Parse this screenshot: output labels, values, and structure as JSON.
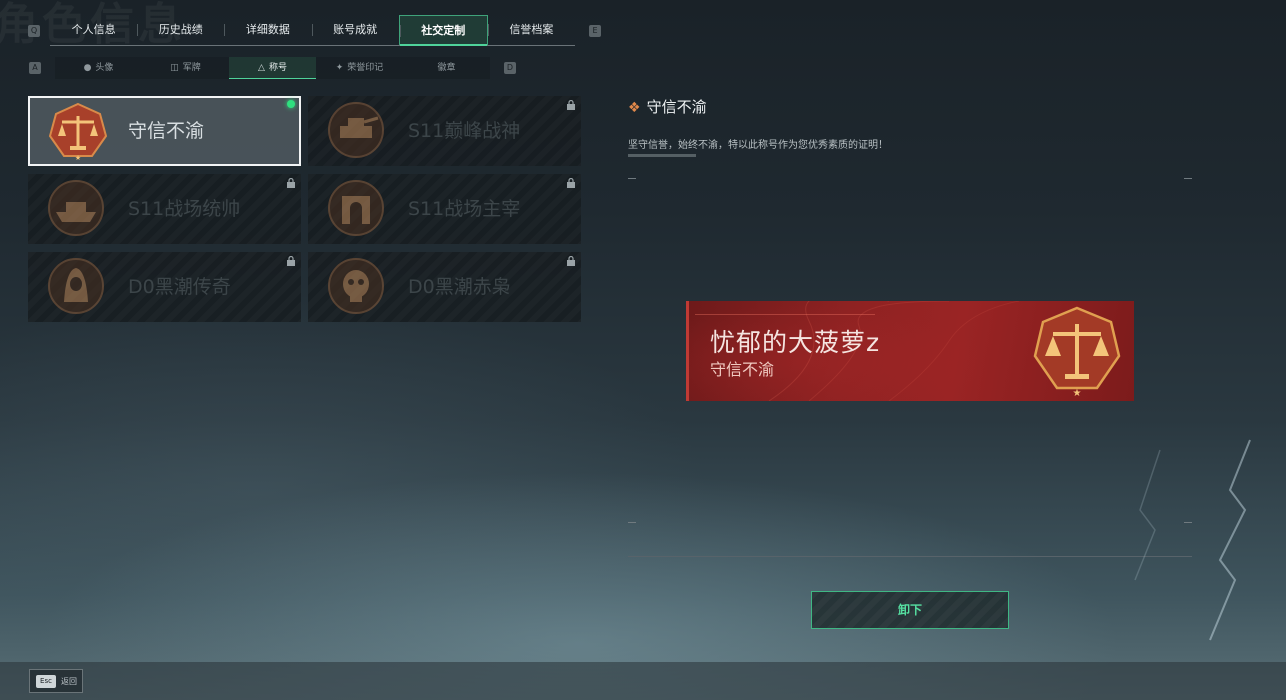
{
  "header_faded_title": "角色信息",
  "keyhints": {
    "prev_tab": "Q",
    "next_tab": "E",
    "prev_subtab": "A",
    "next_subtab": "D"
  },
  "tabs": [
    {
      "label": "个人信息"
    },
    {
      "label": "历史战绩"
    },
    {
      "label": "详细数据"
    },
    {
      "label": "账号成就"
    },
    {
      "label": "社交定制",
      "active": true
    },
    {
      "label": "信誉档案"
    }
  ],
  "subtabs": [
    {
      "label": "头像",
      "icon": "person-icon"
    },
    {
      "label": "军牌",
      "icon": "dogtag-icon"
    },
    {
      "label": "称号",
      "icon": "title-icon",
      "active": true
    },
    {
      "label": "荣誉印记",
      "icon": "emblem-icon"
    },
    {
      "label": "徽章",
      "icon": ""
    }
  ],
  "titles": [
    {
      "name": "守信不渝",
      "selected": true,
      "equipped": true,
      "locked": false,
      "medal": "scales-medal"
    },
    {
      "name": "S11巅峰战神",
      "locked": true,
      "medal": "tank-medal"
    },
    {
      "name": "S11战场统帅",
      "locked": true,
      "medal": "ship-medal"
    },
    {
      "name": "S11战场主宰",
      "locked": true,
      "medal": "arch-medal"
    },
    {
      "name": "D0黑潮传奇",
      "locked": true,
      "medal": "hooded-medal"
    },
    {
      "name": "D0黑潮赤枭",
      "locked": true,
      "medal": "skull-medal"
    }
  ],
  "detail": {
    "title": "守信不渝",
    "description": "坚守信誉，始终不渝，特以此称号作为您优秀素质的证明！"
  },
  "preview_banner": {
    "player_name": "忧郁的大菠萝z",
    "title": "守信不渝"
  },
  "unequip_button": "卸下",
  "footer": {
    "esc_key": "Esc",
    "back_label": "返回"
  },
  "colors": {
    "accent_green": "#4fd39a",
    "banner_red": "#8e2222",
    "equipped_dot": "#2fe07f"
  }
}
